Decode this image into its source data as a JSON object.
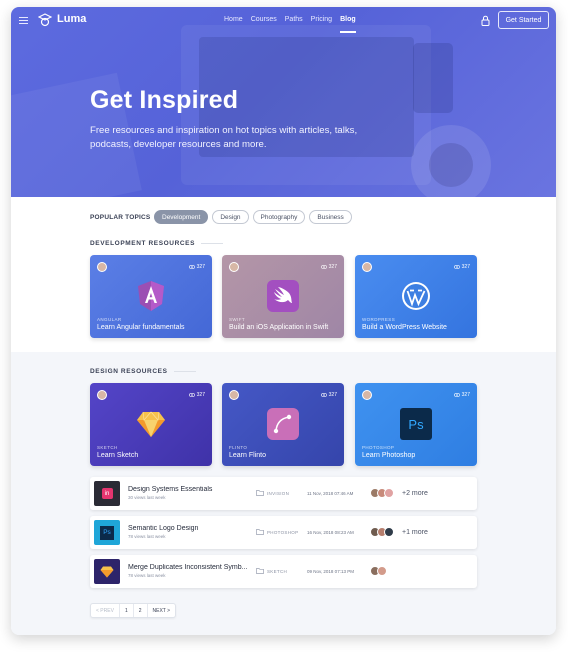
{
  "nav": {
    "brand": "Luma",
    "links": [
      "Home",
      "Courses",
      "Paths",
      "Pricing",
      "Blog"
    ],
    "active": "Blog",
    "cta": "Get Started"
  },
  "hero": {
    "title": "Get Inspired",
    "subtitle": "Free resources and inspiration on hot topics with articles, talks, podcasts, developer resources and more."
  },
  "topics": {
    "label": "POPULAR TOPICS",
    "chips": [
      "Development",
      "Design",
      "Photography",
      "Business"
    ],
    "active": "Development"
  },
  "development": {
    "heading": "DEVELOPMENT RESOURCES",
    "cards": [
      {
        "category": "ANGULAR",
        "title": "Learn Angular fundamentals",
        "views": "327",
        "icon": "angular-icon",
        "bg": "#4e74dd"
      },
      {
        "category": "SWIFT",
        "title": "Build an iOS Application in Swift",
        "views": "327",
        "icon": "swift-icon",
        "bg": "#a58aa6"
      },
      {
        "category": "WORDPRESS",
        "title": "Build a WordPress Website",
        "views": "327",
        "icon": "wordpress-icon",
        "bg": "#3f7fe3"
      }
    ]
  },
  "design": {
    "heading": "DESIGN RESOURCES",
    "cards": [
      {
        "category": "SKETCH",
        "title": "Learn Sketch",
        "views": "327",
        "icon": "sketch-icon",
        "bg": "#4a3fb8"
      },
      {
        "category": "FLINTO",
        "title": "Learn Flinto",
        "views": "327",
        "icon": "flinto-icon",
        "bg": "#3d4fb6"
      },
      {
        "category": "PHOTOSHOP",
        "title": "Learn Photoshop",
        "views": "327",
        "icon": "photoshop-icon",
        "bg": "#3a86ea"
      }
    ]
  },
  "articles": [
    {
      "title": "Design Systems Essentials",
      "meta": "30 views last week",
      "category": "INVISION",
      "date": "11 Nov, 2018 07:46 AM",
      "more": "+2 more",
      "thumb": "invision-icon",
      "thumb_bg": "#2b2b35"
    },
    {
      "title": "Semantic Logo Design",
      "meta": "78 views last week",
      "category": "PHOTOSHOP",
      "date": "16 Nov, 2018 08:23 AM",
      "more": "+1 more",
      "thumb": "photoshop-icon",
      "thumb_bg": "#1fa6d8"
    },
    {
      "title": "Merge Duplicates Inconsistent Symb...",
      "meta": "78 views last week",
      "category": "SKETCH",
      "date": "09 Nov, 2018 07:13 PM",
      "more": "",
      "thumb": "sketch-icon",
      "thumb_bg": "#2d246a"
    }
  ],
  "pager": {
    "prev": "< PREV",
    "pages": [
      "1",
      "2"
    ],
    "next": "NEXT >"
  }
}
